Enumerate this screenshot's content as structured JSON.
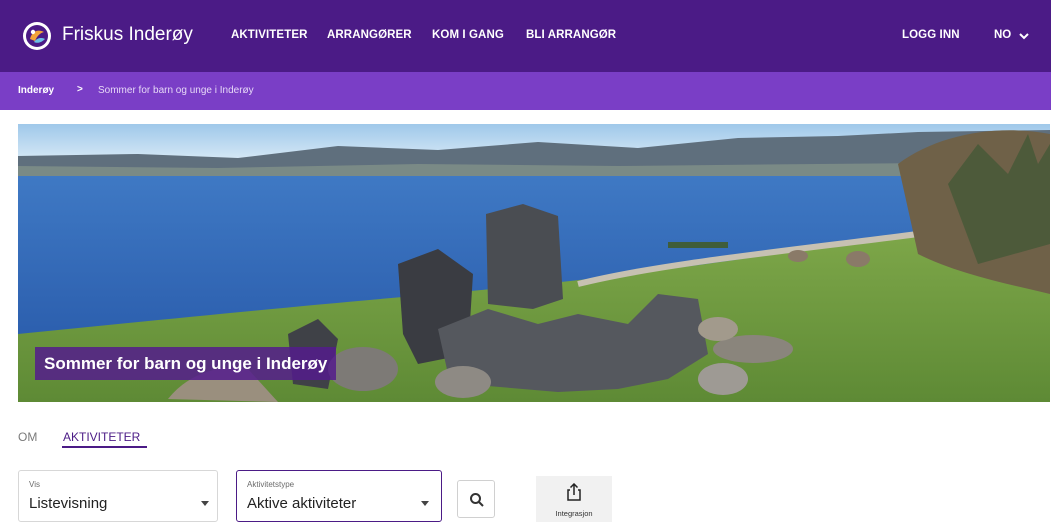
{
  "header": {
    "brand": "Friskus Inderøy",
    "nav": [
      "AKTIVITETER",
      "ARRANGØRER",
      "KOM I GANG",
      "BLI ARRANGØR"
    ],
    "login": "LOGG INN",
    "language": "NO"
  },
  "breadcrumb": {
    "home": "Inderøy",
    "separator": ">",
    "current": "Sommer for barn og unge i Inderøy"
  },
  "hero": {
    "title": "Sommer for barn og unge i Inderøy"
  },
  "tabs": {
    "about": "OM",
    "activities": "AKTIVITETER"
  },
  "filters": {
    "view": {
      "label": "Vis",
      "value": "Listevisning"
    },
    "activity_type": {
      "label": "Aktivitetstype",
      "value": "Aktive aktiviteter"
    }
  },
  "integration": {
    "label": "Integrasjon"
  },
  "icons": {
    "logo": "friskus-logo-icon",
    "language_caret": "chevron-down-icon",
    "search": "search-icon",
    "share": "share-export-icon"
  },
  "colors": {
    "header_bg": "#4b1b86",
    "breadcrumb_bg": "#7a3ec6",
    "accent": "#4b1b86"
  }
}
